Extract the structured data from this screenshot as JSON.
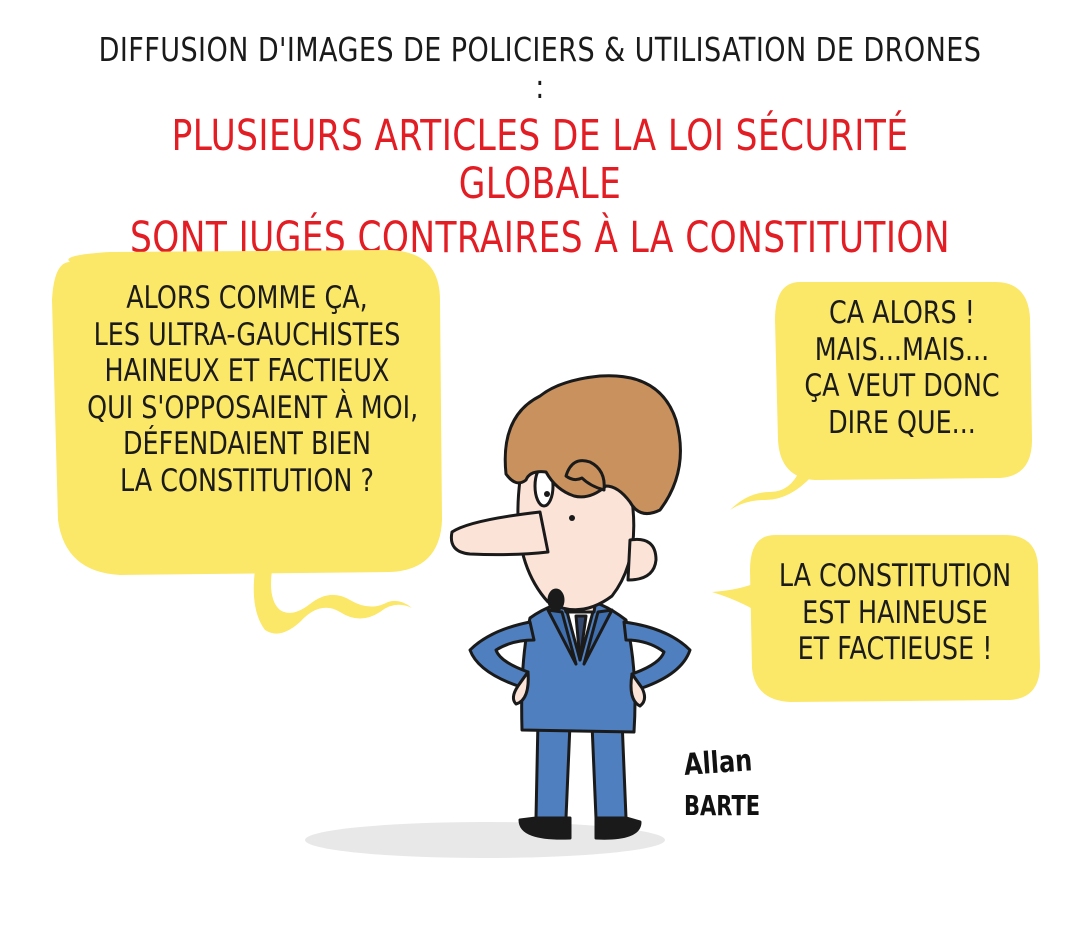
{
  "header": {
    "subtitle": "Diffusion d'images de policiers & utilisation de drones :",
    "headline_lines": [
      "Plusieurs articles de la loi sécurité globale",
      "sont jugés contraires à la Constitution"
    ]
  },
  "bubbles": {
    "left": {
      "lines": [
        "Alors comme ça,",
        "les ultra-gauchistes",
        "haineux et factieux",
        "qui s'opposaient à moi,",
        "défendaient bien",
        "la Constitution ?"
      ]
    },
    "right_top": {
      "lines": [
        "Ca alors !",
        "Mais...mais...",
        "ça veut donc",
        "dire que..."
      ]
    },
    "right_bottom": {
      "lines": [
        "La Constitution",
        "est  haineuse",
        "et factieuse !"
      ]
    }
  },
  "signature": {
    "first": "Allan",
    "last": "BARTE"
  },
  "colors": {
    "bubble": "#fbe768",
    "headline": "#e21d24",
    "suit": "#4f7fbf",
    "hair": "#c8915e",
    "skin": "#fbe3d8"
  }
}
